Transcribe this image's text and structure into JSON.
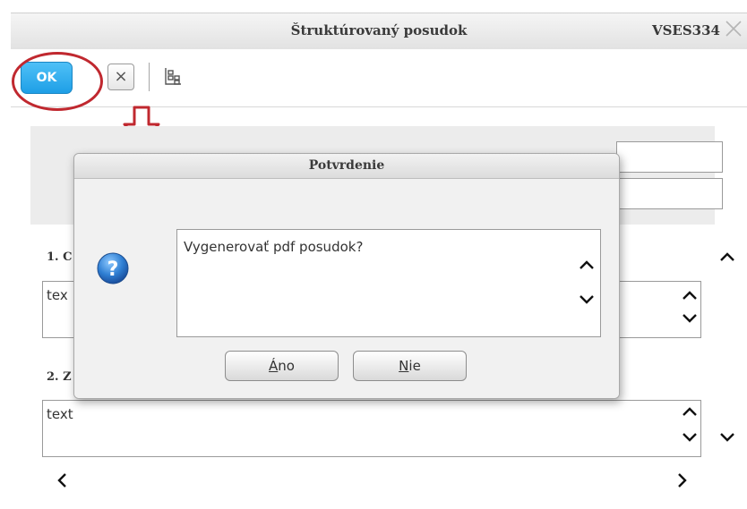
{
  "window": {
    "title": "Štruktúrovaný posudok",
    "code": "VSES334"
  },
  "toolbar": {
    "ok_label": "OK",
    "cancel_glyph": "×",
    "icons": [
      "close-icon",
      "tree-icon"
    ]
  },
  "sections": [
    {
      "label": "1. C",
      "text": "tex"
    },
    {
      "label": "2. Z",
      "text": "text"
    }
  ],
  "dialog": {
    "title": "Potvrdenie",
    "message": "Vygenerovať pdf posudok?",
    "yes_label_first": "Á",
    "yes_label_rest": "no",
    "no_label_first": "N",
    "no_label_rest": "ie",
    "icon": "question-icon"
  },
  "colors": {
    "ok_button": "#1e9fe6",
    "annotation_red": "#c0282f",
    "question_blue": "#2f7fd3"
  }
}
